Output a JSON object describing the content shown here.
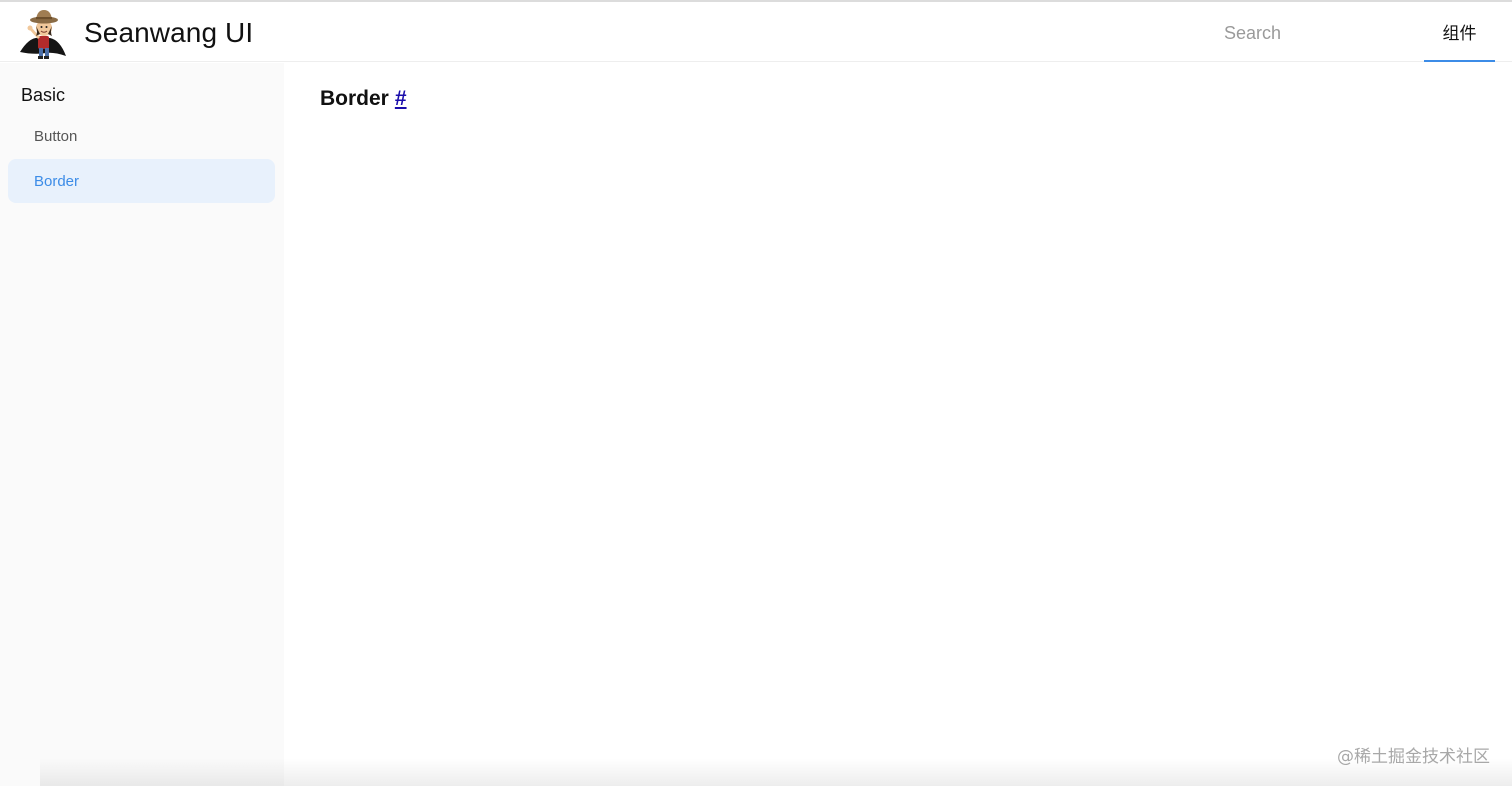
{
  "header": {
    "logo_icon": "pirate-character-avatar",
    "site_title": "Seanwang UI",
    "search": {
      "placeholder": "Search",
      "value": ""
    },
    "nav": [
      {
        "label": "组件",
        "active": true
      }
    ]
  },
  "sidebar": {
    "groups": [
      {
        "title": "Basic",
        "items": [
          {
            "label": "Button",
            "active": false
          },
          {
            "label": "Border",
            "active": true
          }
        ]
      }
    ]
  },
  "main": {
    "heading": "Border",
    "anchor": "#"
  },
  "watermark": "@稀土掘金技术社区",
  "colors": {
    "accent": "#3c8ce7",
    "active_bg": "#e8f1fc",
    "sidebar_bg": "#fafafa",
    "link": "#1a0dab"
  }
}
